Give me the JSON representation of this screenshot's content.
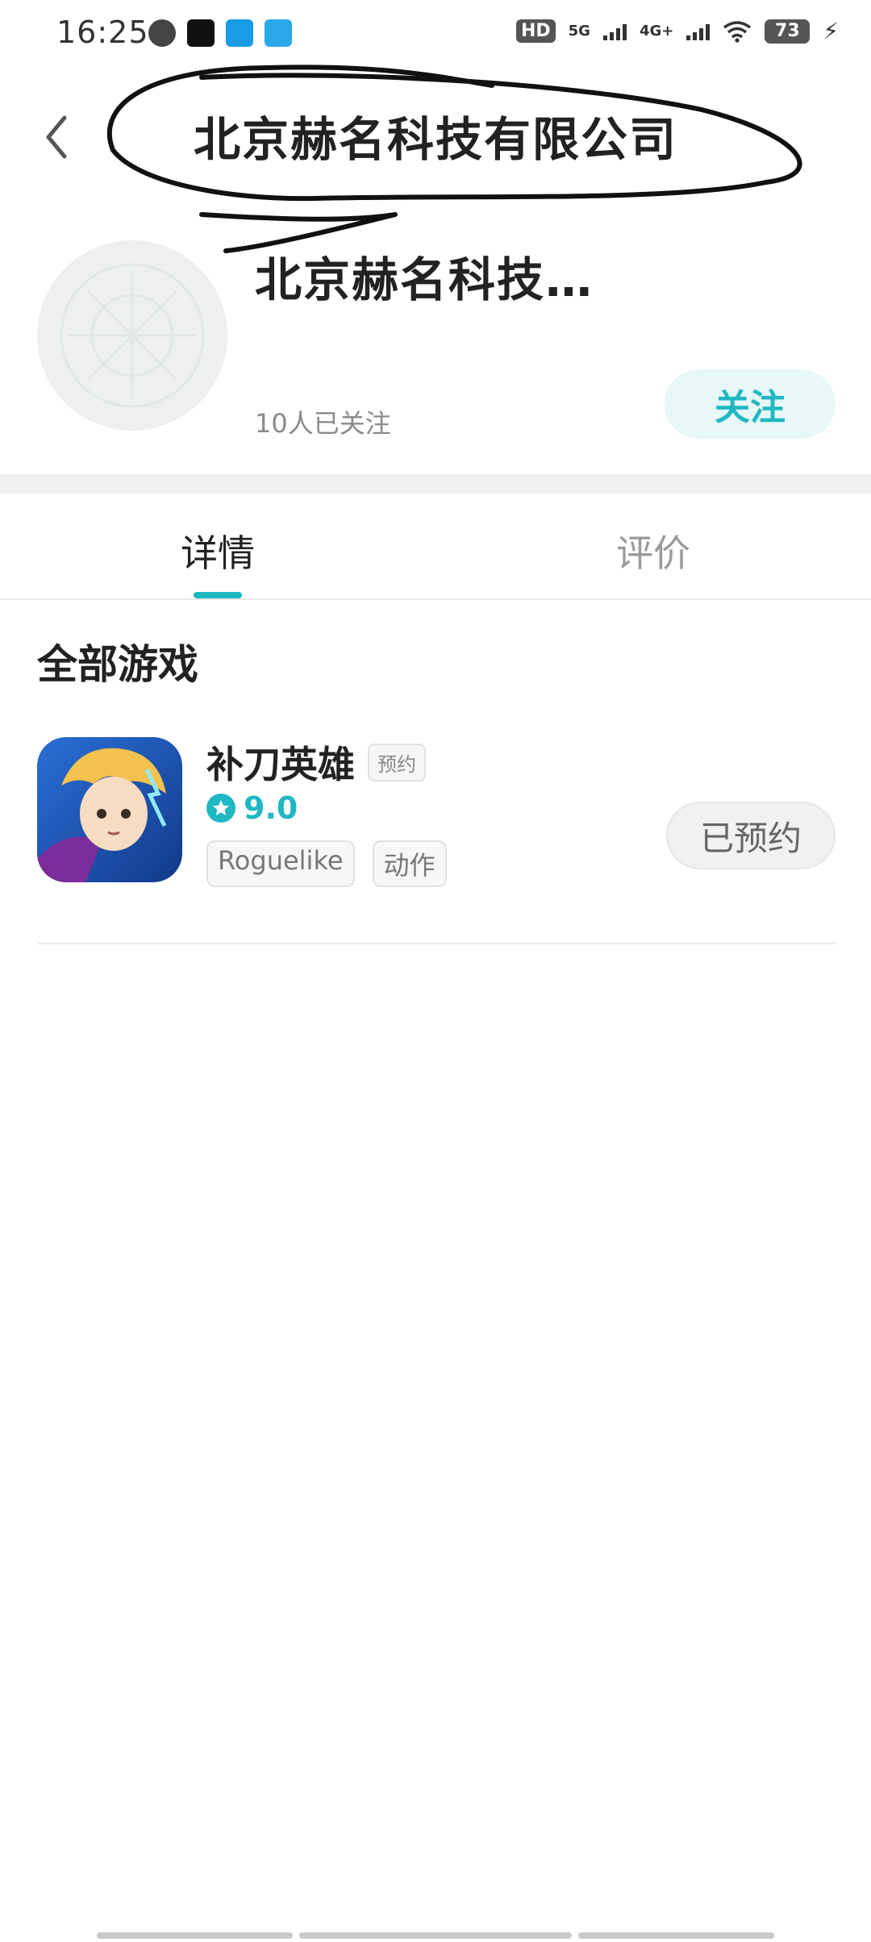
{
  "status_bar": {
    "time": "16:25",
    "hd_label": "HD",
    "net_5g": "5G",
    "net_4g": "4G+",
    "battery": "73",
    "icons": [
      "gauge-icon",
      "tiktok-icon",
      "browser-icon",
      "plane-icon",
      "wifi-icon",
      "charging-icon"
    ]
  },
  "header": {
    "title": "北京赫名科技有限公司"
  },
  "company": {
    "name": "北京赫名科技…",
    "followers": "10人已关注",
    "follow_label": "关注"
  },
  "tabs": [
    {
      "label": "详情",
      "active": true
    },
    {
      "label": "评价",
      "active": false
    }
  ],
  "games_section": {
    "title": "全部游戏",
    "items": [
      {
        "title": "补刀英雄",
        "badge": "预约",
        "rating": "9.0",
        "tags": [
          "Roguelike",
          "动作"
        ],
        "action_label": "已预约"
      }
    ]
  },
  "colors": {
    "accent": "#1fb8c2",
    "follow_bg": "#e8f7f8",
    "muted": "#9a9a9a"
  }
}
